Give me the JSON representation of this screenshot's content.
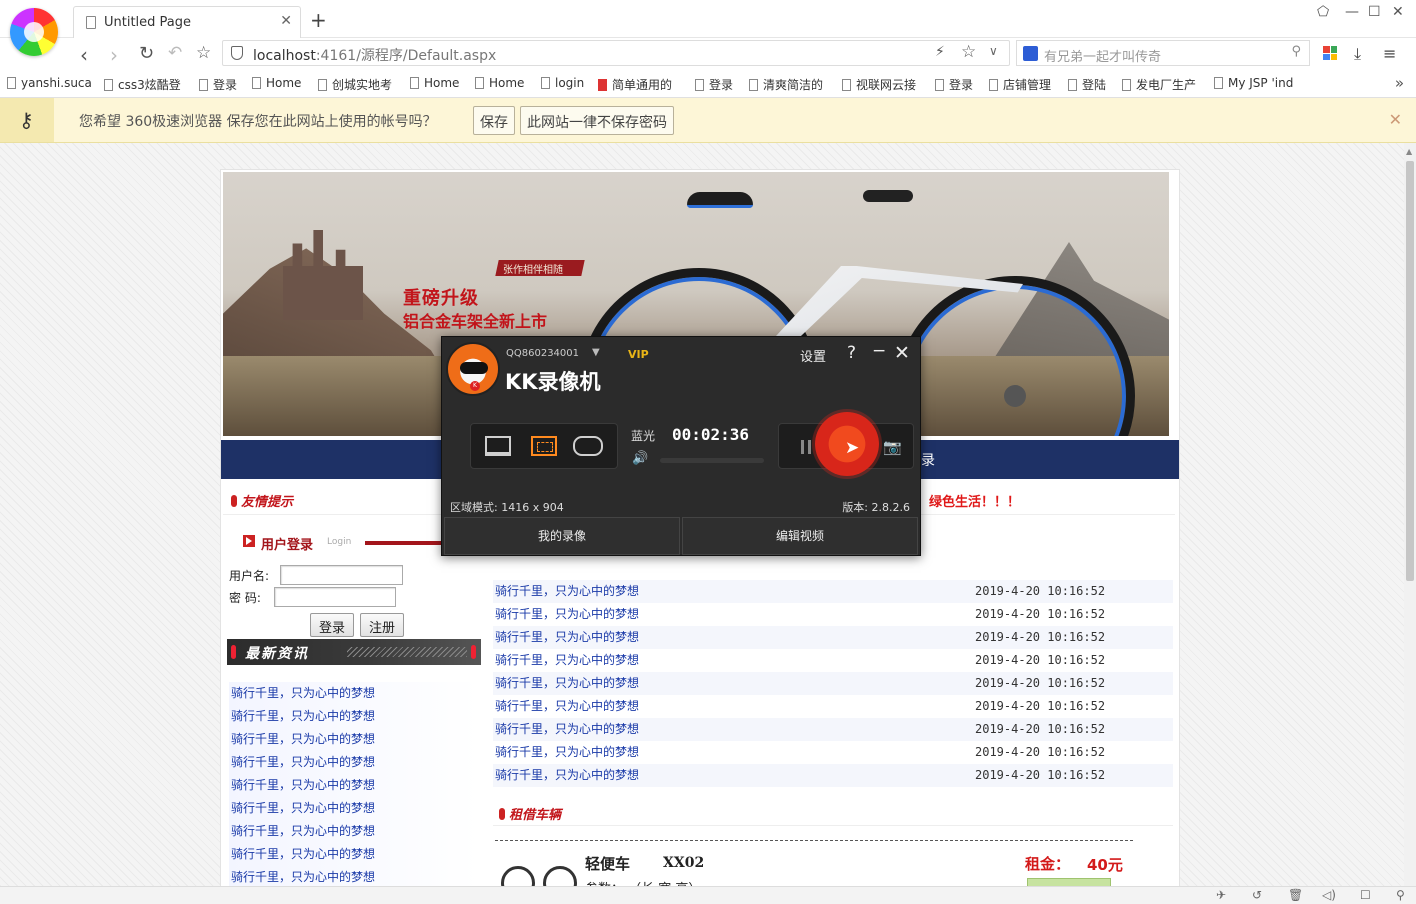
{
  "browser": {
    "tab_title": "Untitled Page",
    "url_host": "localhost",
    "url_rest": ":4161/源程序/Default.aspx",
    "search_placeholder": "有兄弟一起才叫传奇",
    "bookmarks": [
      "yanshi.suca",
      "css3炫酷登",
      "登录",
      "Home",
      "创城实地考",
      "Home",
      "Home",
      "login",
      "简单通用的",
      "登录",
      "清爽简洁的",
      "视联网云接",
      "登录",
      "店铺管理",
      "登陆",
      "发电厂生产",
      "My JSP 'ind"
    ]
  },
  "infobar": {
    "message": "您希望 360极速浏览器 保存您在此网站上使用的帐号吗？",
    "save": "保存",
    "never_save": "此网站一律不保存密码"
  },
  "banner": {
    "brush_text": "张作相伴相随",
    "slogan1": "重磅升级",
    "slogan2": "铝合金车架全新上市"
  },
  "site": {
    "nav_item": "录",
    "tips_title": "友情提示",
    "marquee": "绿色生活！！！",
    "login": {
      "title": "用户登录",
      "subtitle": "Login",
      "username_label": "用户名:",
      "password_label": "密  码:",
      "login_btn": "登录",
      "register_btn": "注册"
    },
    "latest_title": "最新资讯",
    "left_news": [
      "骑行千里，只为心中的梦想",
      "骑行千里，只为心中的梦想",
      "骑行千里，只为心中的梦想",
      "骑行千里，只为心中的梦想",
      "骑行千里，只为心中的梦想",
      "骑行千里，只为心中的梦想",
      "骑行千里，只为心中的梦想",
      "骑行千里，只为心中的梦想",
      "骑行千里，只为心中的梦想"
    ],
    "right_news": [
      {
        "title": "骑行千里，只为心中的梦想",
        "date": "2019-4-20 10:16:52"
      },
      {
        "title": "骑行千里，只为心中的梦想",
        "date": "2019-4-20 10:16:52"
      },
      {
        "title": "骑行千里，只为心中的梦想",
        "date": "2019-4-20 10:16:52"
      },
      {
        "title": "骑行千里，只为心中的梦想",
        "date": "2019-4-20 10:16:52"
      },
      {
        "title": "骑行千里，只为心中的梦想",
        "date": "2019-4-20 10:16:52"
      },
      {
        "title": "骑行千里，只为心中的梦想",
        "date": "2019-4-20 10:16:52"
      },
      {
        "title": "骑行千里，只为心中的梦想",
        "date": "2019-4-20 10:16:52"
      },
      {
        "title": "骑行千里，只为心中的梦想",
        "date": "2019-4-20 10:16:52"
      },
      {
        "title": "骑行千里，只为心中的梦想",
        "date": "2019-4-20 10:16:52"
      }
    ],
    "rent_title": "租借车辆",
    "car": {
      "name": "轻便车",
      "code": "XX02",
      "rent_label": "租金：",
      "price": "40元",
      "params": "参数：                    （长  宽  高）"
    }
  },
  "kk": {
    "account": "QQ860234001",
    "vip": "VIP",
    "name": "KK录像机",
    "settings": "设置",
    "help": "?",
    "audio": "蓝光",
    "elapsed": "00:02:36",
    "region_mode": "区域模式: 1416 x 904",
    "version": "版本: 2.8.2.6",
    "my_recordings": "我的录像",
    "edit_video": "编辑视频"
  },
  "colors": {
    "navbar": "#1e3166",
    "accent_red": "#c2151b",
    "link_blue": "#1a3aa8",
    "infobar_bg": "#fdf6d7",
    "kk_orange": "#ef6d18"
  }
}
